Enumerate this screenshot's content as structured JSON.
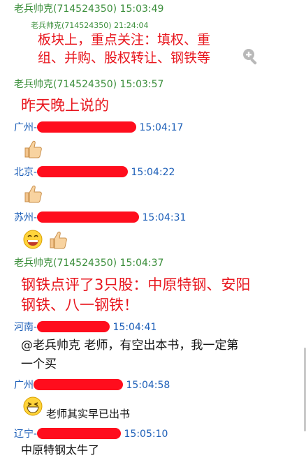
{
  "messages": [
    {
      "sender": "老兵帅克(714524350)",
      "time": "15:03:49",
      "quote": {
        "meta": "老兵帅克(714524350) 21:24:04",
        "lines": [
          "板块上，重点关注：填权、重",
          "组、并购、股权转让、钢铁等"
        ]
      }
    },
    {
      "sender": "老兵帅克(714524350)",
      "time": "15:03:57",
      "text": "昨天晚上说的"
    },
    {
      "sender": "广州-",
      "time": "15:04:17",
      "emoji": "thumbs-up"
    },
    {
      "sender": "北京-",
      "time": "15:04:22",
      "emoji": "thumbs-up"
    },
    {
      "sender": "苏州-",
      "time": "15:04:31",
      "emoji": "grin-thumbs-up"
    },
    {
      "sender": "老兵帅克(714524350)",
      "time": "15:04:37",
      "lines": [
        "钢铁点评了3只股：中原特钢、安阳",
        "钢铁、八一钢铁！"
      ]
    },
    {
      "sender": "河南-",
      "time": "15:04:41",
      "lines": [
        "@老兵帅克 老师，有空出本书，我一定第",
        "一个买"
      ]
    },
    {
      "sender": "广州",
      "time": "15:04:58",
      "text": "老师其实早已出书"
    },
    {
      "sender": "辽宁-",
      "time": "15:05:10",
      "text": "中原特钢太牛了"
    }
  ]
}
